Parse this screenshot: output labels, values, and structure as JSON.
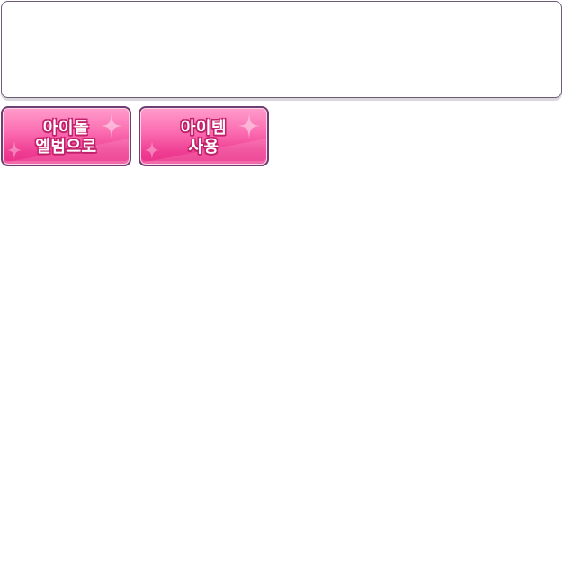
{
  "message_box": {
    "text": ""
  },
  "buttons": {
    "idol_album": {
      "line1": "아이돌",
      "line2": "엘범으로"
    },
    "use_item": {
      "line1": "아이템",
      "line2": "사용"
    }
  },
  "colors": {
    "button_top": "#ff9ccb",
    "button_bottom": "#ea2f87",
    "button_border": "#6e3f73",
    "panel_border": "#6e5a7a"
  },
  "icons": {
    "sparkle": "sparkle-icon"
  }
}
